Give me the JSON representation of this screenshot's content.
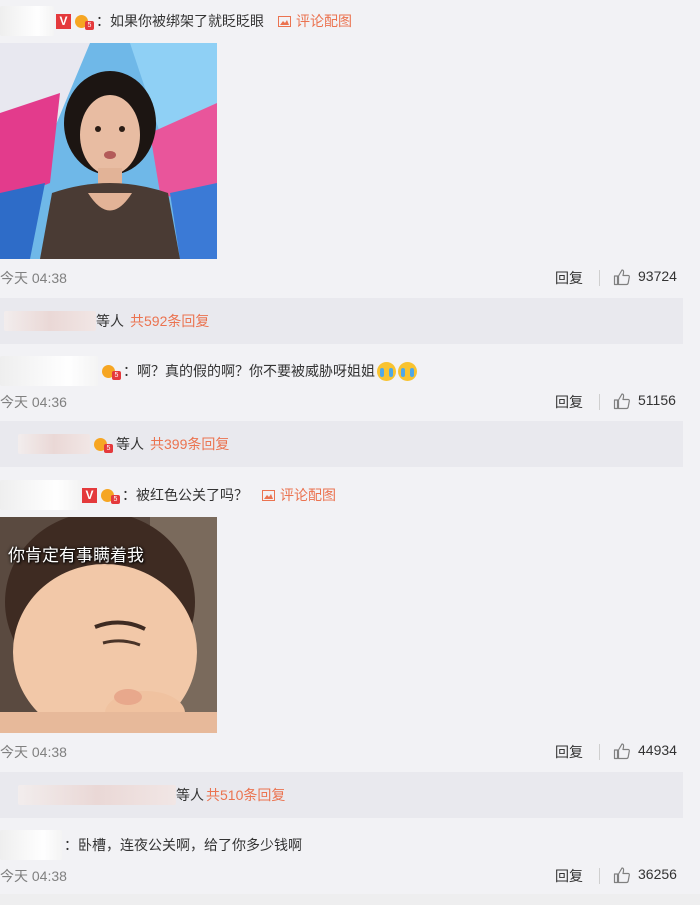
{
  "comments": [
    {
      "text": "：如果你被绑架了就眨眨眼",
      "has_vip": true,
      "has_fans_badge": true,
      "pic_label": "评论配图",
      "image_caption": "",
      "time": "今天 04:38",
      "reply_label": "回复",
      "likes": "93724",
      "thread": {
        "others": "等人",
        "count": "共592条回复"
      }
    },
    {
      "text": "：啊？真的假的啊？你不要被威胁呀姐姐",
      "has_vip": false,
      "has_fans_badge": true,
      "emojis": [
        "crying-face-emoji",
        "crying-face-emoji"
      ],
      "time": "今天 04:36",
      "reply_label": "回复",
      "likes": "51156",
      "thread": {
        "others": "等人",
        "count": "共399条回复"
      }
    },
    {
      "text": "：被红色公关了吗？",
      "has_vip": true,
      "has_fans_badge": true,
      "pic_label": "评论配图",
      "image_caption": "你肯定有事瞒着我",
      "time": "今天 04:38",
      "reply_label": "回复",
      "likes": "44934",
      "thread": {
        "others": "等人",
        "count": "共510条回复"
      }
    },
    {
      "text": "：卧槽，连夜公关啊，给了你多少钱啊",
      "has_vip": false,
      "has_fans_badge": false,
      "time": "今天 04:38",
      "reply_label": "回复",
      "likes": "36256"
    }
  ],
  "badges": {
    "vip": "V"
  },
  "colors": {
    "background": "#f2f2f5",
    "accent": "#eb7350",
    "meta_text": "#808080",
    "reply_box": "#e9e9ee"
  }
}
